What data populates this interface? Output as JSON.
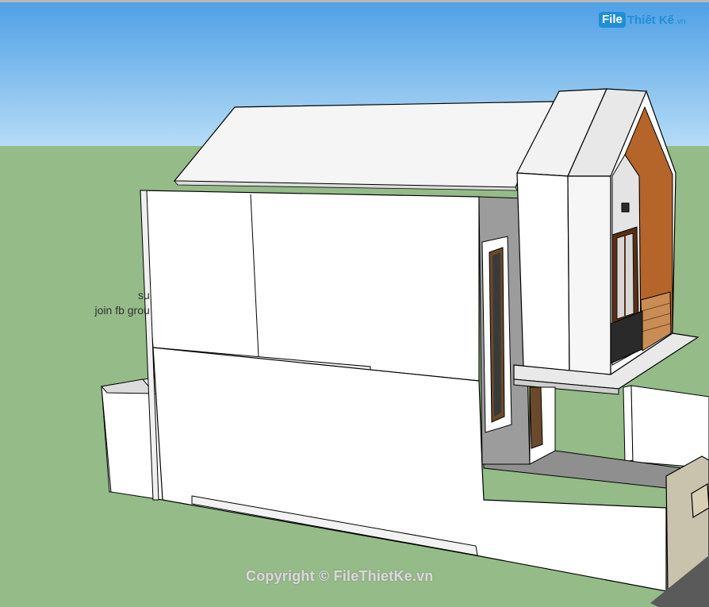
{
  "logo": {
    "file": "File",
    "rest": "Thiết Kế",
    "tld": ".vn"
  },
  "annotation": {
    "line1": "su",
    "line2": "join fb grou"
  },
  "copyright": "Copyright © FileThietKe.vn",
  "colors": {
    "sky": "#5fa8e8",
    "ground": "#94bb88",
    "wall": "#ffffff",
    "wood": "#b5652a",
    "shadow": "#9a9a9a"
  }
}
